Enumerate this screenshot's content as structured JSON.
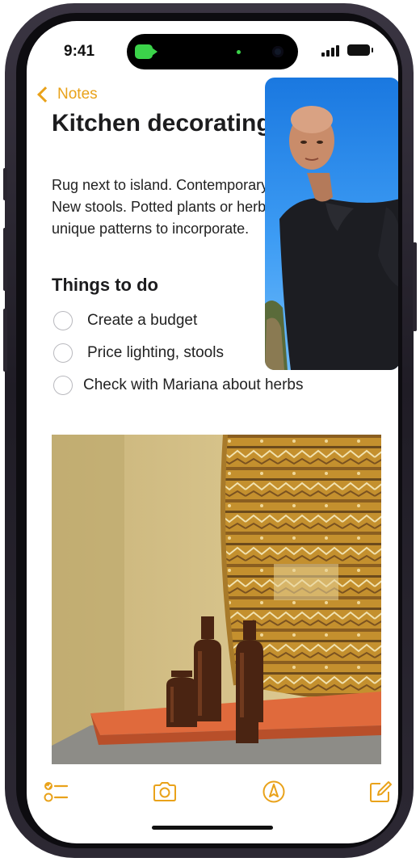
{
  "status_bar": {
    "time": "9:41"
  },
  "nav": {
    "back_label": "Notes"
  },
  "note": {
    "title": "Kitchen decorating",
    "body_lines": [
      "Rug next to island. Contemporary lighting.",
      "New stools. Potted plants or herbs. Find",
      "unique patterns to incorporate."
    ],
    "section_heading": "Things to do",
    "checklist": [
      {
        "label": "Create a budget",
        "checked": false
      },
      {
        "label": "Price lighting, stools",
        "checked": false
      },
      {
        "label": "Check with Mariana about herbs",
        "checked": false
      }
    ]
  },
  "toolbar": {
    "icons": [
      "checklist-icon",
      "camera-icon",
      "markup-icon",
      "compose-icon"
    ]
  },
  "colors": {
    "accent": "#E9A21A",
    "facetime_green": "#3BD34A"
  }
}
